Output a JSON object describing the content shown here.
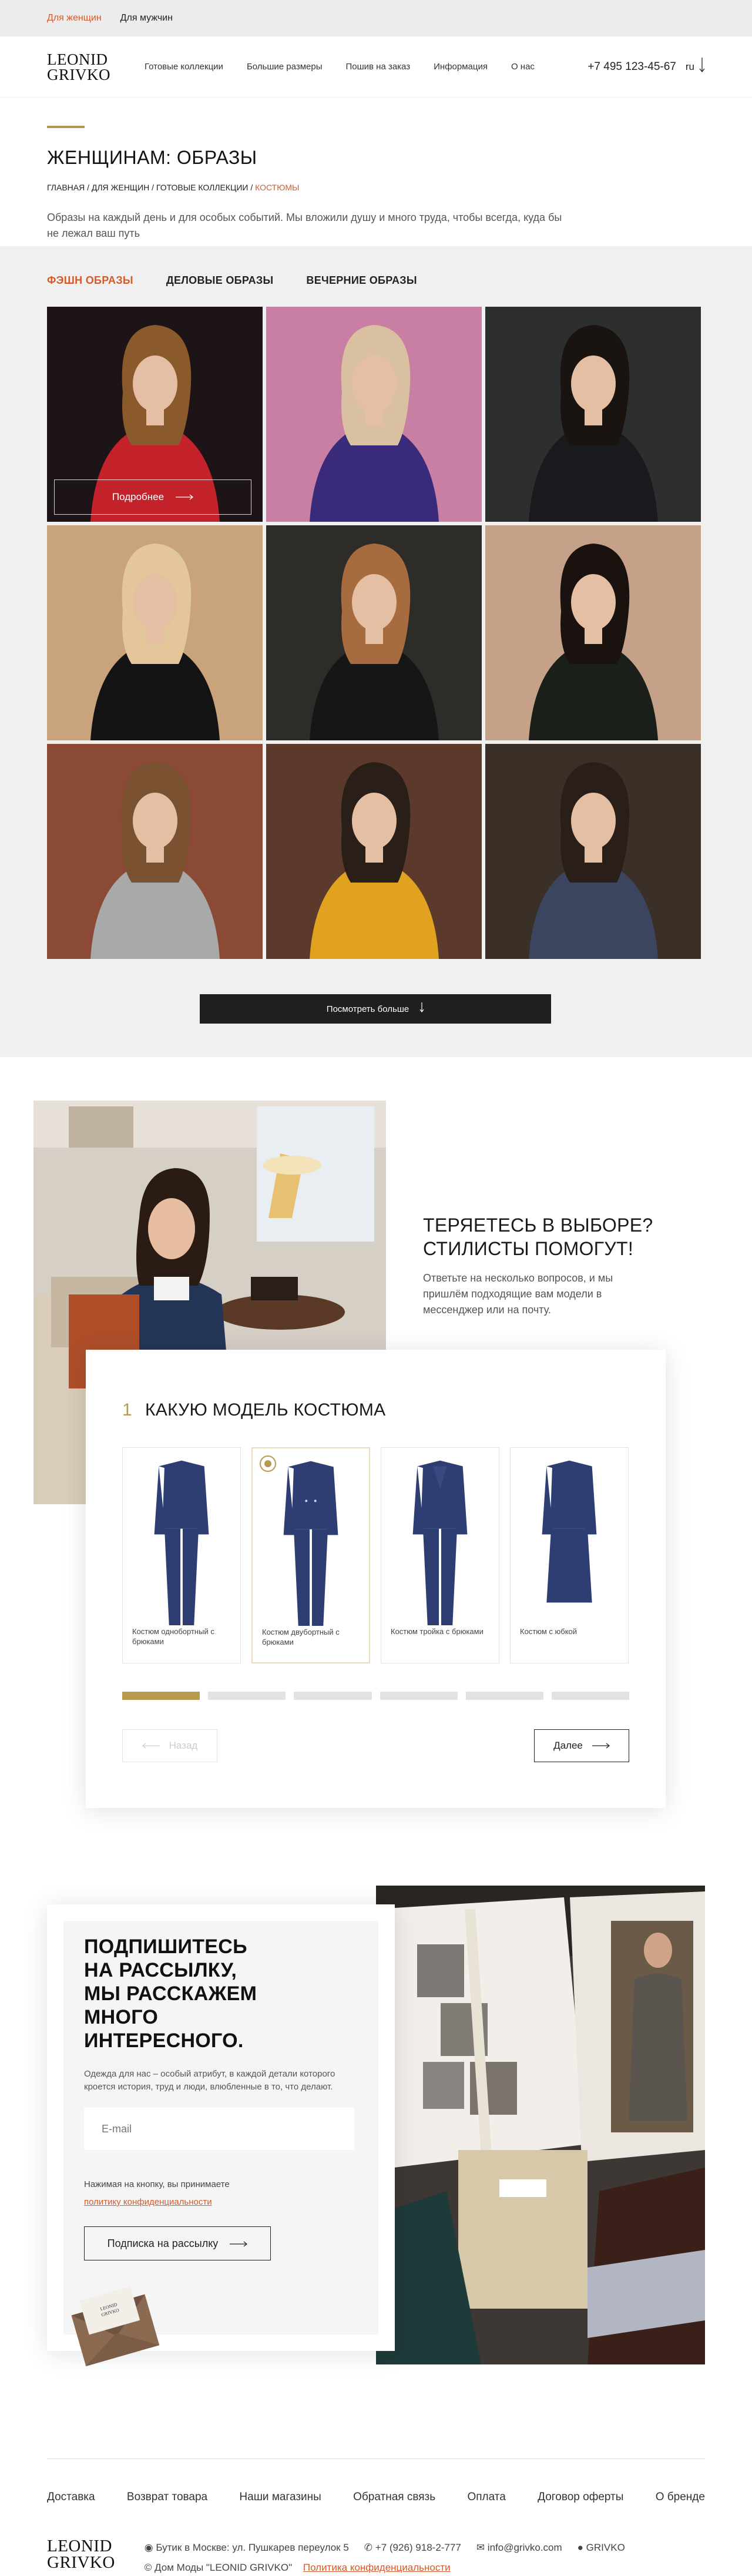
{
  "topbar": {
    "women": "Для женщин",
    "men": "Для мужчин"
  },
  "header": {
    "logo_line1": "LEONID",
    "logo_line2": "GRIVKO",
    "nav": [
      "Готовые коллекции",
      "Большие размеры",
      "Пошив на заказ",
      "Информация",
      "О нас"
    ],
    "phone": "+7 495 123-45-67",
    "lang": "ru"
  },
  "page": {
    "title": "ЖЕНЩИНАМ: ОБРАЗЫ",
    "breadcrumb": [
      "ГЛАВНАЯ",
      "ДЛЯ ЖЕНЩИН",
      "ГОТОВЫЕ КОЛЛЕКЦИИ",
      "КОСТЮМЫ"
    ],
    "intro": "Образы на каждый день и для особых событий. Мы вложили душу и много труда, чтобы всегда, куда бы не лежал ваш путь"
  },
  "gallery": {
    "tabs": [
      "ФЭШН ОБРАЗЫ",
      "ДЕЛОВЫЕ ОБРАЗЫ",
      "ВЕЧЕРНИЕ ОБРАЗЫ"
    ],
    "active_tab": 0,
    "details_label": "Подробнее",
    "see_more": "Посмотреть больше",
    "photos": [
      {
        "bg": "#1c1416",
        "suit": "#c3222a",
        "hair": "#8a5a2c"
      },
      {
        "bg": "#c97fa4",
        "suit": "#3a2a7a",
        "hair": "#d8c0a0"
      },
      {
        "bg": "#2d2f2e",
        "suit": "#1a1a1e",
        "hair": "#1a1410"
      },
      {
        "bg": "#c9a37c",
        "suit": "#141414",
        "hair": "#e3c79a"
      },
      {
        "bg": "#2e2c28",
        "suit": "#161616",
        "hair": "#a66b3e"
      },
      {
        "bg": "#c6a18a",
        "suit": "#1b1f1a",
        "hair": "#1a120e"
      },
      {
        "bg": "#8a4a36",
        "suit": "#a9a9a9",
        "hair": "#7a5232"
      },
      {
        "bg": "#5b3a2c",
        "suit": "#e0a21f",
        "hair": "#2a1e18"
      },
      {
        "bg": "#3a3027",
        "suit": "#3c4560",
        "hair": "#2a1e18"
      }
    ]
  },
  "quiz": {
    "headline_line1": "ТЕРЯЕТЕСЬ В ВЫБОРЕ?",
    "headline_line2": "СТИЛИСТЫ ПОМОГУТ!",
    "subtext": "Ответьте на несколько вопросов, и мы пришлём подходящие вам модели в мессенджер или на почту.",
    "step_number": "1",
    "question": "КАКУЮ МОДЕЛЬ КОСТЮМА",
    "options": [
      "Костюм однобортный с брюками",
      "Костюм двубортный с брюками",
      "Костюм тройка с брюками",
      "Костюм с юбкой"
    ],
    "selected_option": 1,
    "progress_steps": 6,
    "progress_current": 1,
    "back_label": "Назад",
    "next_label": "Далее",
    "suit_color": "#2e3e73"
  },
  "subscribe": {
    "title_line1": "ПОДПИШИТЕСЬ",
    "title_line2": "НА РАССЫЛКУ,",
    "title_line3": "МЫ РАССКАЖЕМ МНОГО",
    "title_line4": "ИНТЕРЕСНОГО.",
    "text": "Одежда для нас – особый атрибут, в каждой детали которого кроется история, труд и люди, влюбленные в то, что делают.",
    "email_placeholder": "E-mail",
    "consent_text": "Нажимая на кнопку, вы принимаете",
    "consent_link": "политику конфиденциальности",
    "button": "Подписка на рассылку"
  },
  "footer": {
    "links": [
      "Доставка",
      "Возврат товара",
      "Наши магазины",
      "Обратная связь",
      "Оплата",
      "Договор оферты",
      "О бренде"
    ],
    "address": "Бутик в Москве: ул. Пушкарев переулок 5",
    "phone": "+7 (926) 918-2-777",
    "email": "info@grivko.com",
    "social": "GRIVKO",
    "copyright": "© Дом Моды \"LEONID GRIVKO\"",
    "privacy": "Политика конфиденциальности",
    "logo_line1": "LEONID",
    "logo_line2": "GRIVKO"
  },
  "colors": {
    "accent": "#d35a2a",
    "gold": "#b79a4f",
    "dark": "#1f1f1f"
  }
}
